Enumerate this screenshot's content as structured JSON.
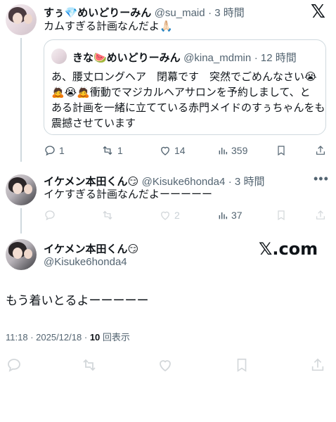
{
  "tweet1": {
    "display_name": "すぅ💎めいどりーみん",
    "handle": "@su_maid",
    "time": "· 3 時間",
    "text": "カムすぎる計画なんだよ🙏🏻",
    "quote": {
      "display_name": "きな🍉めいどりーみん",
      "handle": "@kina_mdmin",
      "time": "· 12 時間",
      "lines": [
        "あ、腰丈ロングヘア　閉幕です　突然でごめんなさい😭",
        "🙇😭🙇衝動でマジカルヘアサロンを予約しまして、と",
        "ある計画を一緒に立てている赤門メイドのすぅちゃんをも",
        "震撼させています"
      ]
    },
    "actions": {
      "replies": "1",
      "retweets": "1",
      "likes": "14",
      "views": "359"
    }
  },
  "tweet2": {
    "display_name": "イケメン本田くん😏",
    "handle": "@Kisuke6honda4",
    "time": "· 3 時間",
    "text": "イケすぎる計画なんだよーーーーー",
    "actions": {
      "replies": "",
      "retweets": "",
      "likes": "2",
      "views": "37"
    },
    "more_icon": "more-dots-icon"
  },
  "main": {
    "display_name": "イケメン本田くん😏",
    "handle": "@Kisuke6honda4",
    "text": "もう着いとるよーーーーー",
    "time": "11:18",
    "date": "· 2025/12/18",
    "views": "10",
    "views_suffix": " 回表示",
    "watermark": "𝕏.com"
  },
  "logo": "𝕏",
  "colors": {
    "text": "#0f1419",
    "muted": "#536471",
    "line": "#cfd9de"
  }
}
